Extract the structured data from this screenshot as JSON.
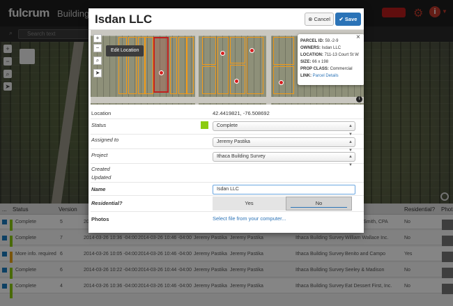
{
  "app": {
    "logo": "fulcrum",
    "title": "Building S",
    "search_placeholder": "Search text"
  },
  "grid": {
    "headers": [
      "...",
      "Status",
      "Version",
      "Residential?",
      "Phot"
    ],
    "rows": [
      {
        "status": "Complete",
        "version": "5",
        "created": "2014-03-26 10:04 -04:00",
        "updated": "2014-03-26 10:04 -04:00",
        "by1": "Jeremy Pastika",
        "by2": "Jeremy Pastika",
        "project": "Ithaca Building Survey",
        "name": "Michael Smith, CPA",
        "residential": "No",
        "color": "#8ccc10"
      },
      {
        "status": "Complete",
        "version": "7",
        "created": "2014-03-26 10:36 -04:00",
        "updated": "2014-03-26 10:46 -04:00",
        "by1": "Jeremy Pastika",
        "by2": "Jeremy Pastika",
        "project": "Ithaca Building Survey",
        "name": "William Wallace Inc.",
        "residential": "No",
        "color": "#8ccc10"
      },
      {
        "status": "More info. required",
        "version": "6",
        "created": "2014-03-26 10:05 -04:00",
        "updated": "2014-03-26 10:46 -04:00",
        "by1": "Jeremy Pastika",
        "by2": "Jeremy Pastika",
        "project": "Ithaca Building Survey",
        "name": "Benito and Campo",
        "residential": "Yes",
        "color": "#e8a317"
      },
      {
        "status": "Complete",
        "version": "6",
        "created": "2014-03-26 10:22 -04:00",
        "updated": "2014-03-26 10:44 -04:00",
        "by1": "Jeremy Pastika",
        "by2": "Jeremy Pastika",
        "project": "Ithaca Building Survey",
        "name": "Seeley & Madison",
        "residential": "No",
        "color": "#8ccc10"
      },
      {
        "status": "Complete",
        "version": "4",
        "created": "2014-03-26 10:36 -04:00",
        "updated": "2014-03-26 10:46 -04:00",
        "by1": "Jeremy Pastika",
        "by2": "Jeremy Pastika",
        "project": "Ithaca Building Survey",
        "name": "Eat Dessert First, Inc.",
        "residential": "No",
        "color": "#8ccc10"
      }
    ]
  },
  "modal": {
    "title": "Isdan LLC",
    "cancel_label": "Cancel",
    "save_label": "Save",
    "edit_location_label": "Edit Location",
    "popup": {
      "parcel_label": "PARCEL ID:",
      "parcel_value": "59.-2-9",
      "owners_label": "OWNERS:",
      "owners_value": "Isdan LLC",
      "location_label": "LOCATION:",
      "location_value": "711-13 Court St W",
      "size_label": "SIZE:",
      "size_value": "66 x 198",
      "propclass_label": "PROP CLASS:",
      "propclass_value": "Commercial",
      "link_label": "LINK:",
      "link_value": "Parcel Details"
    },
    "form": {
      "location_label": "Location",
      "location_value": "42.4419821, -76.508692",
      "status_label": "Status",
      "status_value": "Complete",
      "status_color": "#8ccc10",
      "assigned_label": "Assigned to",
      "assigned_value": "Jeremy Pastika",
      "project_label": "Project",
      "project_value": "Ithaca Building Survey",
      "created_label": "Created",
      "updated_label": "Updated",
      "name_label": "Name",
      "name_value": "Isdan LLC",
      "residential_label": "Residential?",
      "residential_yes": "Yes",
      "residential_no": "No",
      "photos_label": "Photos",
      "photos_link": "Select file from your computer..."
    }
  }
}
